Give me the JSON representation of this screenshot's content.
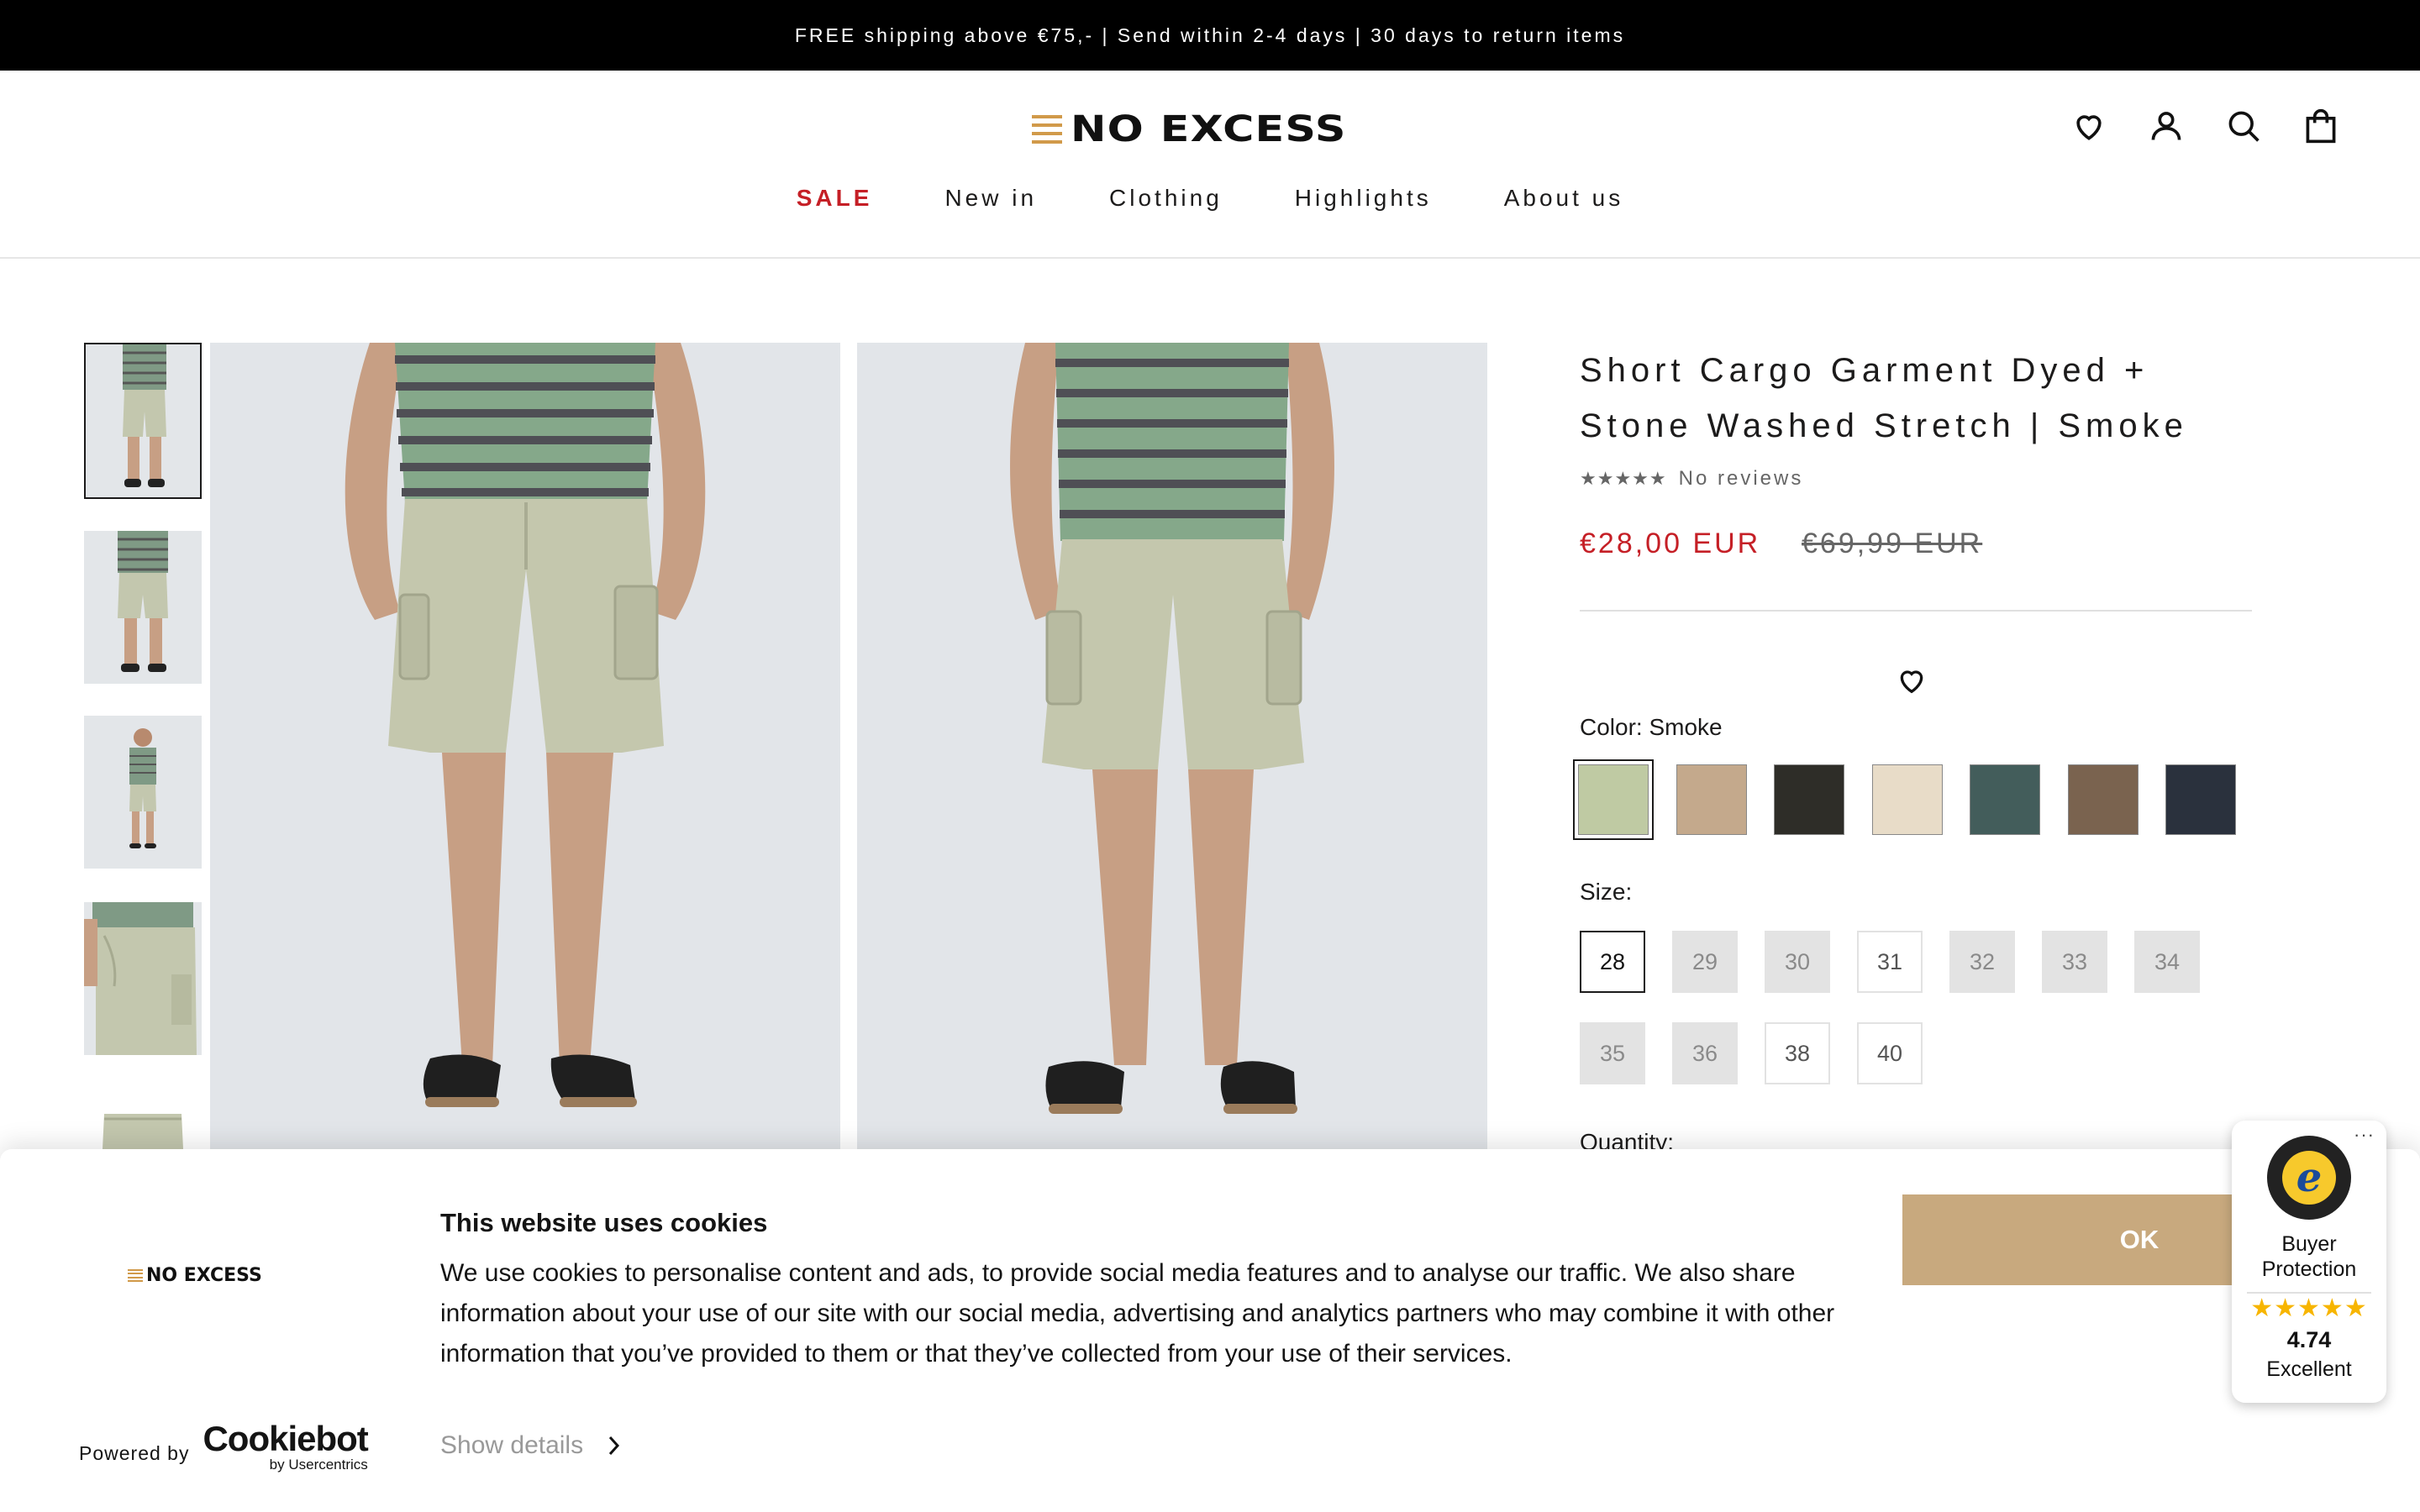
{
  "announcement": "FREE shipping above €75,- | Send within 2-4 days | 30 days to return items",
  "brand": {
    "logo_text": "NO EXCESS",
    "accent": "#d19a4a"
  },
  "header_icons": [
    "heart-icon",
    "account-icon",
    "search-icon",
    "bag-icon"
  ],
  "nav": {
    "sale": "SALE",
    "new_in": "New in",
    "clothing": "Clothing",
    "highlights": "Highlights",
    "about": "About us"
  },
  "product": {
    "title": "Short Cargo Garment Dyed + Stone Washed Stretch | Smoke",
    "reviews": "No reviews",
    "stars": "★★★★★",
    "price": "€28,00 EUR",
    "old_price": "€69,99 EUR",
    "color_label": "Color: Smoke",
    "size_label": "Size:",
    "quantity_label": "Quantity:",
    "colors": [
      {
        "name": "Smoke",
        "hex": "#bfcaa3",
        "selected": true
      },
      {
        "name": "Sand",
        "hex": "#c4a98c"
      },
      {
        "name": "Black",
        "hex": "#2e2d28"
      },
      {
        "name": "Cream",
        "hex": "#e8dcc8"
      },
      {
        "name": "Dark Green",
        "hex": "#435d5b"
      },
      {
        "name": "Brown",
        "hex": "#7a634f"
      },
      {
        "name": "Navy",
        "hex": "#2a313d"
      }
    ],
    "sizes": [
      {
        "label": "28",
        "available": true,
        "selected": true
      },
      {
        "label": "29",
        "available": false
      },
      {
        "label": "30",
        "available": false
      },
      {
        "label": "31",
        "available": true
      },
      {
        "label": "32",
        "available": false
      },
      {
        "label": "33",
        "available": false
      },
      {
        "label": "34",
        "available": false
      },
      {
        "label": "35",
        "available": false
      },
      {
        "label": "36",
        "available": false
      },
      {
        "label": "38",
        "available": true
      },
      {
        "label": "40",
        "available": true
      }
    ]
  },
  "cookie": {
    "title": "This website uses cookies",
    "text": "We use cookies to personalise content and ads, to provide social media features and to analyse our traffic. We also share information about your use of our site with our social media, advertising and analytics partners who may combine it with other information that you’ve provided to them or that they’ve collected from your use of their services.",
    "ok": "OK",
    "powered_by": "Powered by",
    "cookiebot": "Cookiebot",
    "by_usercentrics": "by Usercentrics",
    "show_details": "Show details"
  },
  "trusted_shops": {
    "label": "Buyer Protection",
    "stars": "★★★★★",
    "score": "4.74",
    "rating_word": "Excellent",
    "menu": "···"
  }
}
